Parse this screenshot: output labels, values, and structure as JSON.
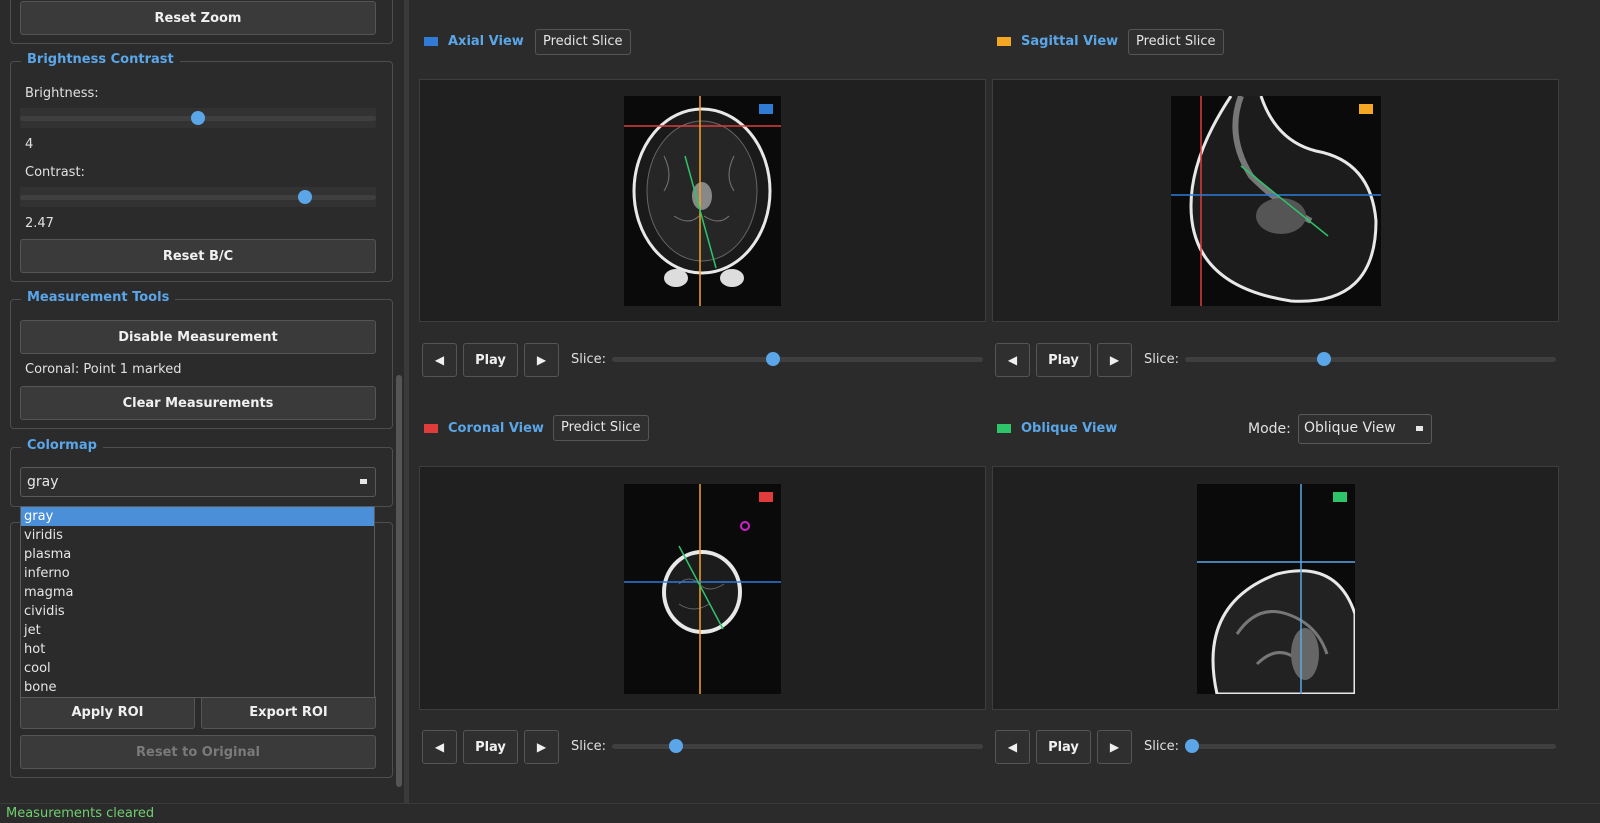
{
  "sidebar": {
    "reset_zoom": "Reset Zoom",
    "bc": {
      "title": "Brightness  Contrast",
      "brightness_label": "Brightness:",
      "brightness_value": "4",
      "brightness_fraction": 0.5,
      "contrast_label": "Contrast:",
      "contrast_value": "2.47",
      "contrast_fraction": 0.8,
      "reset": "Reset B/C"
    },
    "measure": {
      "title": "Measurement Tools",
      "disable": "Disable Measurement",
      "status": "Coronal: Point 1 marked",
      "clear": "Clear Measurements"
    },
    "colormap": {
      "title": "Colormap",
      "selected": "gray",
      "options": [
        "gray",
        "viridis",
        "plasma",
        "inferno",
        "magma",
        "cividis",
        "jet",
        "hot",
        "cool",
        "bone"
      ]
    },
    "roi": {
      "apply": "Apply ROI",
      "export": "Export ROI",
      "reset": "Reset to Original"
    }
  },
  "views": {
    "axial": {
      "title": "Axial View",
      "predict": "Predict Slice",
      "color": "#2f7bd6",
      "slice_fraction": 0.43
    },
    "sagittal": {
      "title": "Sagittal View",
      "predict": "Predict Slice",
      "color": "#f5a623",
      "slice_fraction": 0.37
    },
    "coronal": {
      "title": "Coronal View",
      "predict": "Predict Slice",
      "color": "#e03c3c",
      "slice_fraction": 0.16
    },
    "oblique": {
      "title": "Oblique View",
      "mode_label": "Mode:",
      "mode_value": "Oblique View",
      "color": "#2ec46a",
      "slice_fraction": 0.0
    }
  },
  "controls": {
    "prev": "◀",
    "play": "Play",
    "next": "▶",
    "slice_label": "Slice:"
  },
  "status": "Measurements cleared"
}
